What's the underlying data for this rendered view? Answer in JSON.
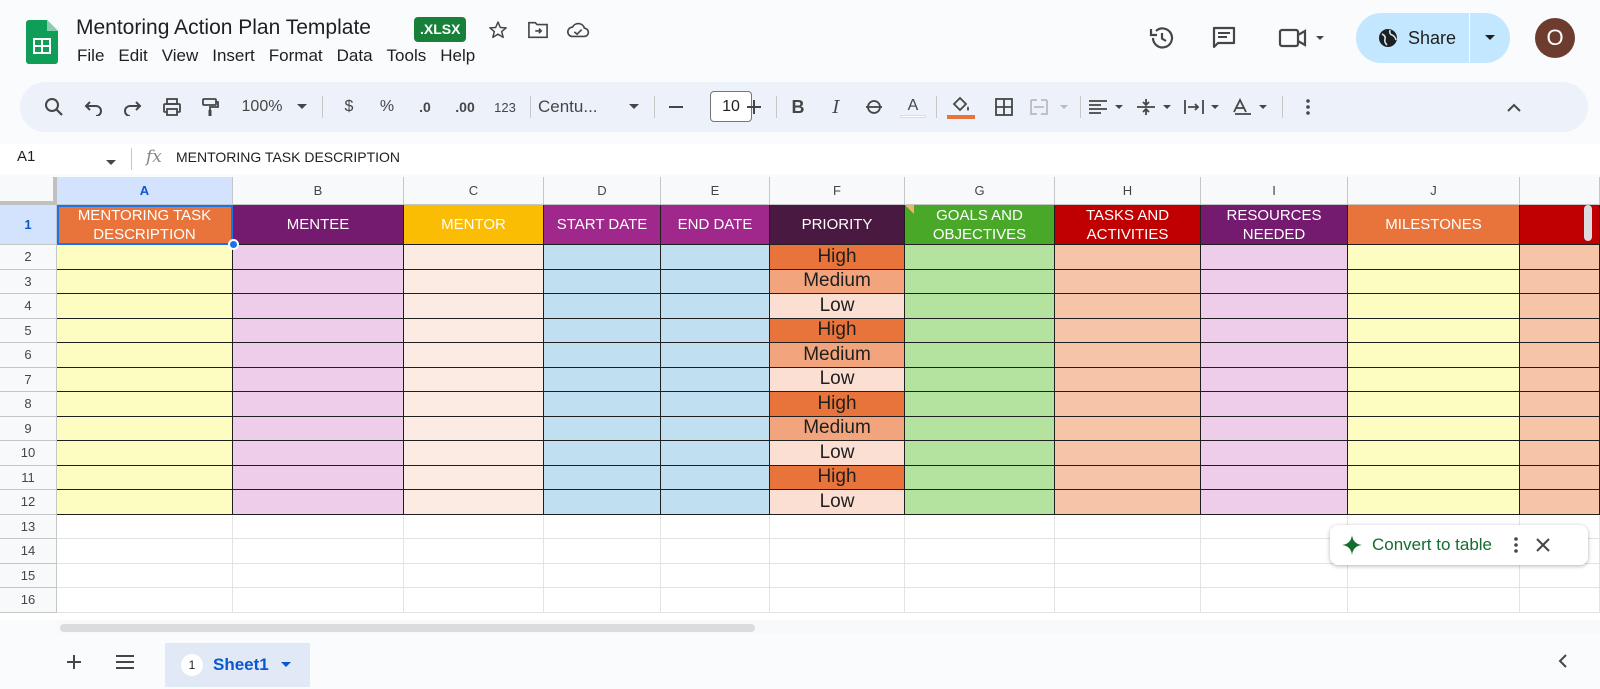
{
  "title": {
    "doc_name": "Mentoring Action Plan Template",
    "format_badge": ".XLSX",
    "menu": [
      "File",
      "Edit",
      "View",
      "Insert",
      "Format",
      "Data",
      "Tools",
      "Help"
    ],
    "share_label": "Share",
    "avatar_initial": "O"
  },
  "toolbar": {
    "zoom": "100%",
    "currency": "$",
    "percent": "%",
    "dec_decrease": ".0",
    "dec_increase": ".00",
    "number_format": "123",
    "font": "Centu...",
    "font_size": "10",
    "bold": "B",
    "italic": "I",
    "text_color": "A"
  },
  "formula_bar": {
    "cell_ref": "A1",
    "fx": "fx",
    "content": "MENTORING TASK DESCRIPTION"
  },
  "grid": {
    "columns": [
      "A",
      "B",
      "C",
      "D",
      "E",
      "F",
      "G",
      "H",
      "I",
      "J"
    ],
    "rows": [
      "1",
      "2",
      "3",
      "4",
      "5",
      "6",
      "7",
      "8",
      "9",
      "10",
      "11",
      "12",
      "13",
      "14",
      "15",
      "16"
    ],
    "headers": [
      {
        "text": "MENTORING TASK DESCRIPTION",
        "bg": "#e8743b",
        "col_bg": "#fdfdc1"
      },
      {
        "text": "MENTEE",
        "bg": "#741b70",
        "col_bg": "#eecdeb"
      },
      {
        "text": "MENTOR",
        "bg": "#fbbc04",
        "col_bg": "#fcebe2"
      },
      {
        "text": "START DATE",
        "bg": "#a0288c",
        "col_bg": "#c0dff1"
      },
      {
        "text": "END DATE",
        "bg": "#a0288c",
        "col_bg": "#c0dff1"
      },
      {
        "text": "PRIORITY",
        "bg": "#4a1942",
        "col_bg": "#ffffff"
      },
      {
        "text": "GOALS AND OBJECTIVES",
        "bg": "#4aa829",
        "col_bg": "#b3e39f"
      },
      {
        "text": "TASKS AND ACTIVITIES",
        "bg": "#c00000",
        "col_bg": "#f6c5a8"
      },
      {
        "text": "RESOURCES NEEDED",
        "bg": "#741b70",
        "col_bg": "#eecdeb"
      },
      {
        "text": "MILESTONES",
        "bg": "#e8743b",
        "col_bg": "#fdfdc1"
      },
      {
        "text": "",
        "bg": "#c00000",
        "col_bg": "#f6c5a8"
      }
    ],
    "priorities": [
      {
        "text": "High",
        "bg": "#e8743b"
      },
      {
        "text": "Medium",
        "bg": "#f2a57c"
      },
      {
        "text": "Low",
        "bg": "#fbdfd2"
      },
      {
        "text": "High",
        "bg": "#e8743b"
      },
      {
        "text": "Medium",
        "bg": "#f2a57c"
      },
      {
        "text": "Low",
        "bg": "#fbdfd2"
      },
      {
        "text": "High",
        "bg": "#e8743b"
      },
      {
        "text": "Medium",
        "bg": "#f2a57c"
      },
      {
        "text": "Low",
        "bg": "#fbdfd2"
      },
      {
        "text": "High",
        "bg": "#e8743b"
      },
      {
        "text": "Low",
        "bg": "#fbdfd2"
      }
    ]
  },
  "convert_chip": {
    "label": "Convert to table"
  },
  "sheets": {
    "tab_number": "1",
    "tab_name": "Sheet1"
  }
}
